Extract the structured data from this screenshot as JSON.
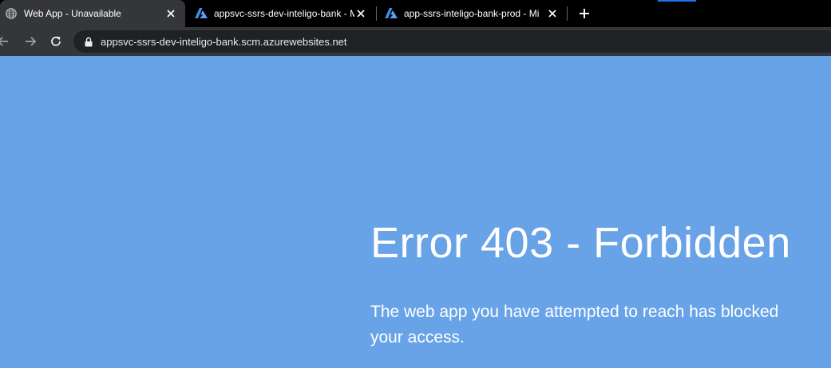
{
  "browser": {
    "tabs": [
      {
        "title": "Web App - Unavailable",
        "icon": "globe-icon",
        "active": true
      },
      {
        "title": "appsvc-ssrs-dev-inteligo-bank - M",
        "icon": "azure-icon",
        "active": false
      },
      {
        "title": "app-ssrs-inteligo-bank-prod - Mi",
        "icon": "azure-icon",
        "active": false
      }
    ],
    "url": "appsvc-ssrs-dev-inteligo-bank.scm.azurewebsites.net"
  },
  "page": {
    "error_title": "Error 403 - Forbidden",
    "error_message": "The web app you have attempted to reach has blocked your access."
  },
  "colors": {
    "page_background": "#68a3e8",
    "tab_strip": "#000000",
    "active_tab": "#35363a",
    "omnibox": "#202124",
    "azure_blue": "#3f8ee8"
  }
}
